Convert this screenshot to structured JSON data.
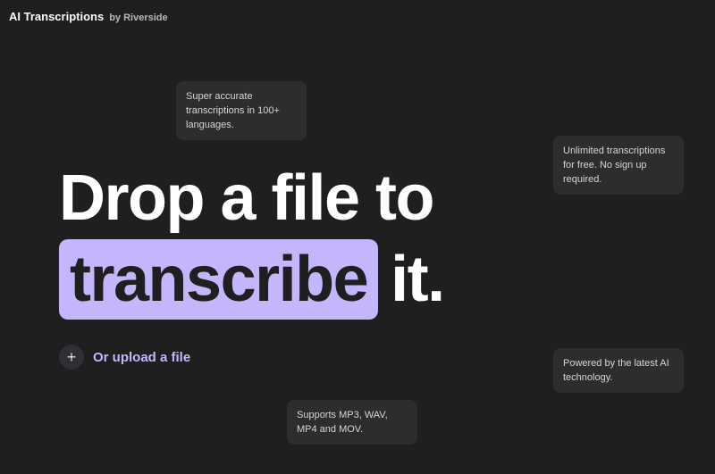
{
  "header": {
    "title": "AI Transcriptions",
    "subtitle": "by Riverside"
  },
  "features": [
    {
      "text": "Super accurate transcriptions in 100+ languages."
    },
    {
      "text": "Unlimited transcriptions for free. No sign up required."
    },
    {
      "text": "Powered by the latest AI technology."
    },
    {
      "text": "Supports MP3, WAV, MP4 and MOV."
    }
  ],
  "hero": {
    "line1": "Drop a file to",
    "highlight": "transcribe",
    "tail": "it."
  },
  "upload": {
    "icon": "plus-icon",
    "label": "Or upload a file"
  },
  "colors": {
    "background": "#1f1f20",
    "accent": "#c4b5fd",
    "bubble": "#2d2d2f"
  }
}
